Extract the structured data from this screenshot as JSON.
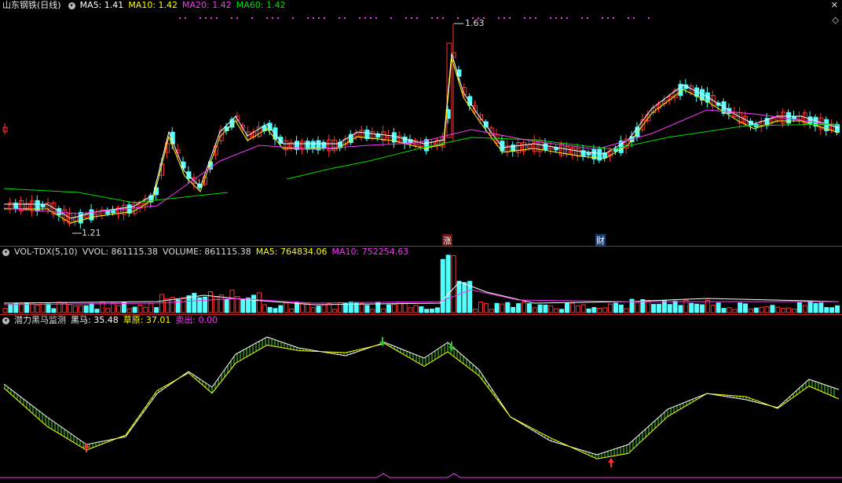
{
  "colors": {
    "up": "#ff3333",
    "down": "#54ffff",
    "ma5": "#ffffff",
    "ma10": "#ffff00",
    "ma20": "#ff33ff",
    "ma60": "#00e000",
    "vol_ma10": "#ff33ff"
  },
  "price_panel": {
    "title": "山东钢铁(日线)",
    "ma5": "MA5: 1.41",
    "ma10": "MA10: 1.42",
    "ma20": "MA20: 1.42",
    "ma60": "MA60: 1.42",
    "high_label": "1.63",
    "low_label": "1.21",
    "event_zhang": "涨",
    "event_cai": "财",
    "toggle_icon": "chevron-down-icon",
    "corner_icons": [
      "close-icon",
      "diamond-icon"
    ]
  },
  "volume_panel": {
    "indicator": "VOL-TDX(5,10)",
    "vvol": "VVOL: 861115.38",
    "volume": "VOLUME: 861115.38",
    "ma5": "MA5: 764834.06",
    "ma10": "MA10: 752254.63"
  },
  "indicator_panel": {
    "name": "潜力黑马监测",
    "heima": "黑马: 35.48",
    "caoyuan": "草原: 37.01",
    "maichu": "卖出: 0.00"
  }
}
